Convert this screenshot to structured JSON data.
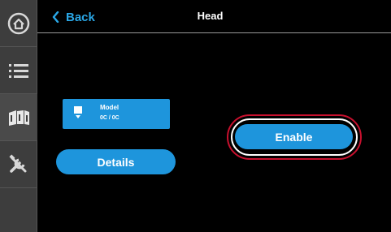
{
  "header": {
    "back_label": "Back",
    "title": "Head"
  },
  "sidebar": {
    "items": [
      {
        "name": "home",
        "icon": "home-icon"
      },
      {
        "name": "menu",
        "icon": "list-icon"
      },
      {
        "name": "material",
        "icon": "filament-icon"
      },
      {
        "name": "tools",
        "icon": "tools-icon"
      }
    ]
  },
  "head_card": {
    "model_label": "Model",
    "temperature": "0C / 0C",
    "icon": "nozzle-icon"
  },
  "buttons": {
    "details_label": "Details",
    "enable_label": "Enable"
  },
  "colors": {
    "accent": "#1e95dc",
    "back_text": "#2aa7e6",
    "highlight_ring": "#c8102e",
    "sidebar_bg": "#3d3d3d"
  }
}
